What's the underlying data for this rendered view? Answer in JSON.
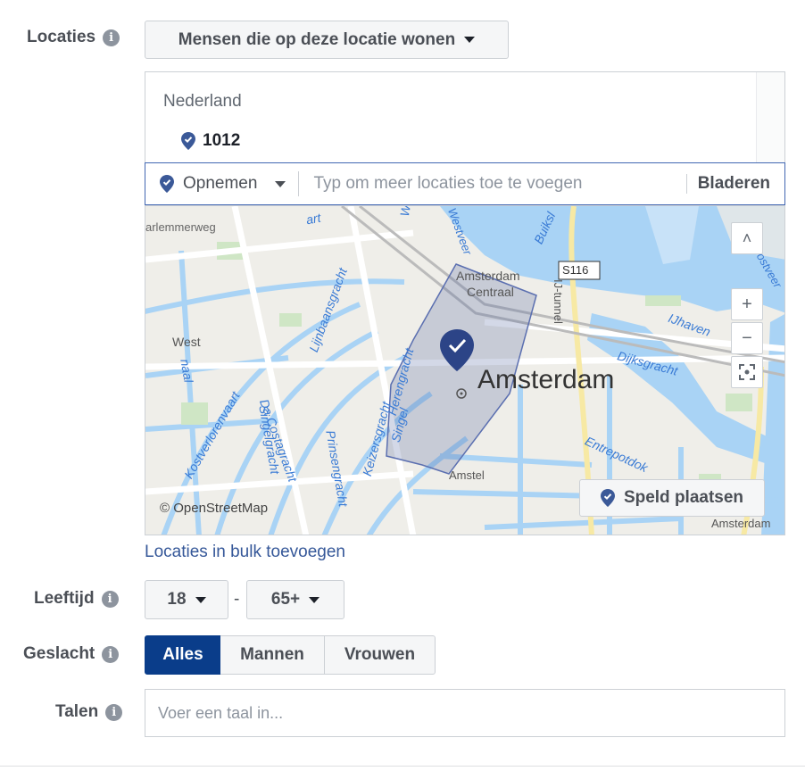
{
  "locations": {
    "label": "Locaties",
    "mode_dropdown": "Mensen die op deze locatie wonen",
    "country": "Nederland",
    "selected": [
      {
        "name": "1012"
      }
    ],
    "include_dropdown": "Opnemen",
    "search_placeholder": "Typ om meer locaties toe te voegen",
    "browse_label": "Bladeren",
    "bulk_link": "Locaties in bulk toevoegen"
  },
  "map": {
    "attribution": "© OpenStreetMap",
    "drop_pin_label": "Speld plaatsen",
    "zoom_in": "+",
    "zoom_out": "−",
    "collapse": "˄",
    "labels": {
      "city": "Amsterdam",
      "station_1": "Amsterdam",
      "station_2": "Centraal",
      "west": "West",
      "haarlemmerweg": "arlemmerweg",
      "art": "art",
      "westerdok": "Wester",
      "ijtunnel": "IJ-tunnel",
      "ijhaven": "IJhaven",
      "dijksgracht": "Dijksgracht",
      "entrepotdok": "Entrepotdok",
      "s116": "S116",
      "oostveer": "Oostveer",
      "lijnbaansgracht": "Lijnbaansgracht",
      "herengracht": "Herengracht",
      "singel": "Singel",
      "singelgracht": "Singelgracht",
      "prinsengracht": "Prinsengracht",
      "keizersgracht": "Keizersgracht",
      "da_costagracht": "Da Costagracht",
      "kostverlorenvaart": "Kostverlorenvaart",
      "kanaal": "naal",
      "amstel": "Amstel",
      "amsterdam_se": "Amsterdam",
      "buiksloot": "Buiksl",
      "westveer": "Westveer"
    }
  },
  "age": {
    "label": "Leeftijd",
    "min": "18",
    "separator": "-",
    "max": "65+"
  },
  "gender": {
    "label": "Geslacht",
    "options": [
      "Alles",
      "Mannen",
      "Vrouwen"
    ],
    "selected": "Alles"
  },
  "languages": {
    "label": "Talen",
    "placeholder": "Voer een taal in..."
  },
  "colors": {
    "accent": "#4267b2",
    "active_segment": "#0a3d8a",
    "pin": "#3b5998",
    "water": "#a9d3f5",
    "link": "#365899"
  }
}
